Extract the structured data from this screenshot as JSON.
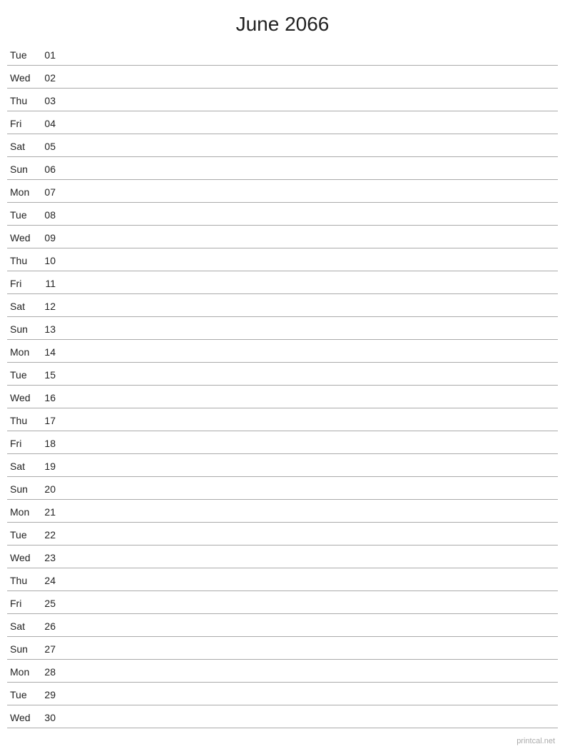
{
  "title": "June 2066",
  "days": [
    {
      "name": "Tue",
      "number": "01"
    },
    {
      "name": "Wed",
      "number": "02"
    },
    {
      "name": "Thu",
      "number": "03"
    },
    {
      "name": "Fri",
      "number": "04"
    },
    {
      "name": "Sat",
      "number": "05"
    },
    {
      "name": "Sun",
      "number": "06"
    },
    {
      "name": "Mon",
      "number": "07"
    },
    {
      "name": "Tue",
      "number": "08"
    },
    {
      "name": "Wed",
      "number": "09"
    },
    {
      "name": "Thu",
      "number": "10"
    },
    {
      "name": "Fri",
      "number": "11"
    },
    {
      "name": "Sat",
      "number": "12"
    },
    {
      "name": "Sun",
      "number": "13"
    },
    {
      "name": "Mon",
      "number": "14"
    },
    {
      "name": "Tue",
      "number": "15"
    },
    {
      "name": "Wed",
      "number": "16"
    },
    {
      "name": "Thu",
      "number": "17"
    },
    {
      "name": "Fri",
      "number": "18"
    },
    {
      "name": "Sat",
      "number": "19"
    },
    {
      "name": "Sun",
      "number": "20"
    },
    {
      "name": "Mon",
      "number": "21"
    },
    {
      "name": "Tue",
      "number": "22"
    },
    {
      "name": "Wed",
      "number": "23"
    },
    {
      "name": "Thu",
      "number": "24"
    },
    {
      "name": "Fri",
      "number": "25"
    },
    {
      "name": "Sat",
      "number": "26"
    },
    {
      "name": "Sun",
      "number": "27"
    },
    {
      "name": "Mon",
      "number": "28"
    },
    {
      "name": "Tue",
      "number": "29"
    },
    {
      "name": "Wed",
      "number": "30"
    }
  ],
  "watermark": "printcal.net"
}
